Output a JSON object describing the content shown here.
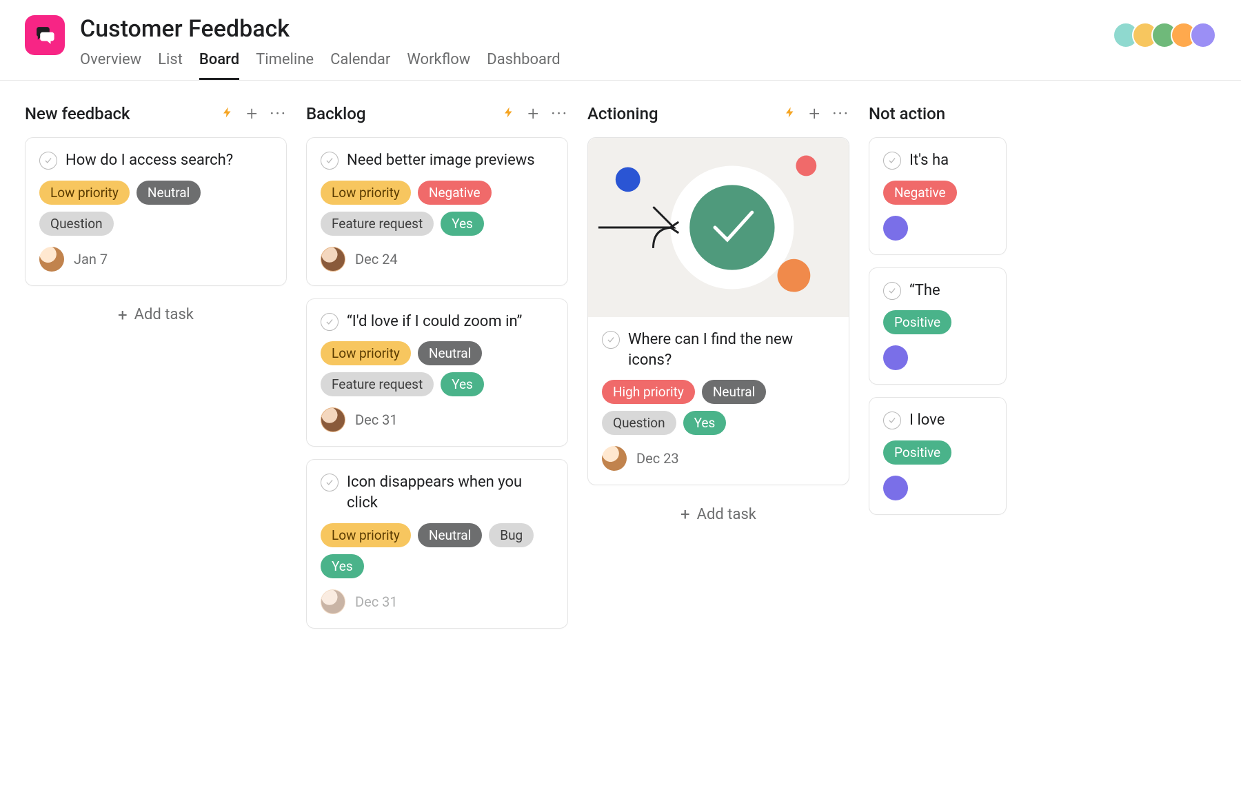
{
  "project": {
    "title": "Customer Feedback",
    "icon": "chat-bubbles"
  },
  "tabs": [
    {
      "label": "Overview",
      "active": false
    },
    {
      "label": "List",
      "active": false
    },
    {
      "label": "Board",
      "active": true
    },
    {
      "label": "Timeline",
      "active": false
    },
    {
      "label": "Calendar",
      "active": false
    },
    {
      "label": "Workflow",
      "active": false
    },
    {
      "label": "Dashboard",
      "active": false
    }
  ],
  "header_member_count": 5,
  "add_task_label": "Add task",
  "columns": [
    {
      "title": "New feedback",
      "show_add_task": true,
      "cards": [
        {
          "title": "How do I access search?",
          "tags": [
            {
              "text": "Low priority",
              "class": "tag-low-priority"
            },
            {
              "text": "Neutral",
              "class": "tag-neutral"
            },
            {
              "text": "Question",
              "class": "tag-question"
            }
          ],
          "avatar_class": "av3",
          "date": "Jan 7"
        }
      ]
    },
    {
      "title": "Backlog",
      "show_add_task": false,
      "cards": [
        {
          "title": "Need better image previews",
          "tags": [
            {
              "text": "Low priority",
              "class": "tag-low-priority"
            },
            {
              "text": "Negative",
              "class": "tag-negative"
            },
            {
              "text": "Feature request",
              "class": "tag-feature-request"
            },
            {
              "text": "Yes",
              "class": "tag-yes"
            }
          ],
          "avatar_class": "av2",
          "date": "Dec 24"
        },
        {
          "title": "“I'd love if I could zoom in”",
          "tags": [
            {
              "text": "Low priority",
              "class": "tag-low-priority"
            },
            {
              "text": "Neutral",
              "class": "tag-neutral"
            },
            {
              "text": "Feature request",
              "class": "tag-feature-request"
            },
            {
              "text": "Yes",
              "class": "tag-yes"
            }
          ],
          "avatar_class": "av2",
          "date": "Dec 31"
        },
        {
          "title": "Icon disappears when you click",
          "tags": [
            {
              "text": "Low priority",
              "class": "tag-low-priority"
            },
            {
              "text": "Neutral",
              "class": "tag-neutral"
            },
            {
              "text": "Bug",
              "class": "tag-bug"
            },
            {
              "text": "Yes",
              "class": "tag-yes"
            }
          ],
          "avatar_class": "av2",
          "date": "Dec 31",
          "faded": true
        }
      ]
    },
    {
      "title": "Actioning",
      "show_add_task": true,
      "cards": [
        {
          "has_cover": true,
          "title": "Where can I find the new icons?",
          "tags": [
            {
              "text": "High priority",
              "class": "tag-high-priority"
            },
            {
              "text": "Neutral",
              "class": "tag-neutral"
            },
            {
              "text": "Question",
              "class": "tag-question"
            },
            {
              "text": "Yes",
              "class": "tag-yes"
            }
          ],
          "avatar_class": "av3",
          "date": "Dec 23"
        }
      ]
    },
    {
      "title": "Not action",
      "show_add_task": false,
      "partial": true,
      "cards": [
        {
          "title": "It's ha",
          "tags": [
            {
              "text": "Negative",
              "class": "tag-negative"
            }
          ],
          "avatar_class": "av4",
          "date": ""
        },
        {
          "title": "“The",
          "tags": [
            {
              "text": "Positive",
              "class": "tag-positive"
            }
          ],
          "avatar_class": "av4",
          "date": ""
        },
        {
          "title": "I love",
          "tags": [
            {
              "text": "Positive",
              "class": "tag-positive"
            }
          ],
          "avatar_class": "av4",
          "date": ""
        }
      ]
    }
  ]
}
